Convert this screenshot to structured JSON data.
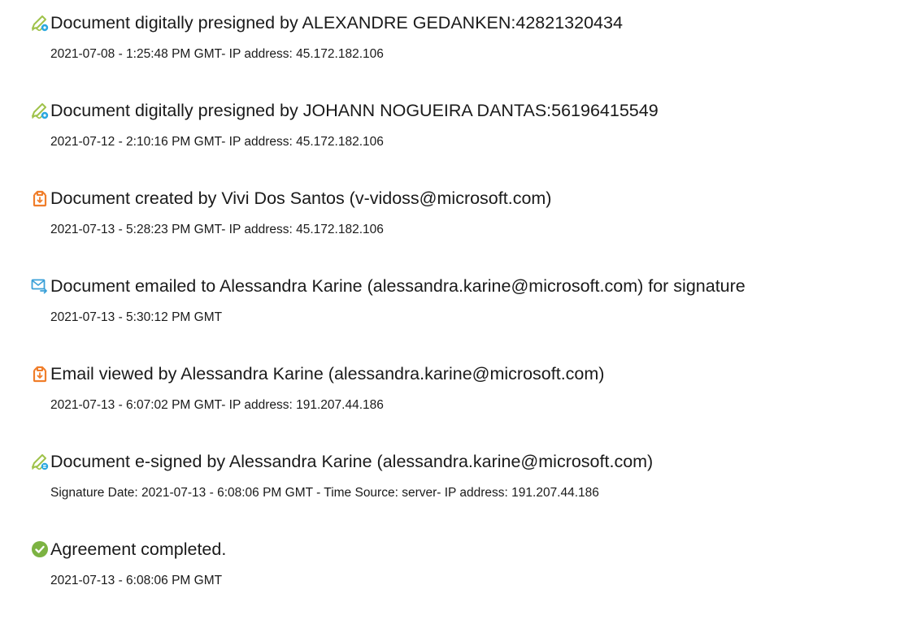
{
  "colors": {
    "text": "#1a1a1a",
    "pen_icon": "#9fc24a",
    "pen_badge": "#2aa8e0",
    "doc_icon": "#f07e2b",
    "mail_icon": "#3aa0d8",
    "check_icon": "#7cb342"
  },
  "events": [
    {
      "icon": "pen-presign-icon",
      "title": "Document digitally presigned by ALEXANDRE GEDANKEN:42821320434",
      "meta": "2021-07-08 - 1:25:48 PM GMT- IP address: 45.172.182.106"
    },
    {
      "icon": "pen-presign-icon",
      "title": "Document digitally presigned by JOHANN NOGUEIRA DANTAS:56196415549",
      "meta": "2021-07-12 - 2:10:16 PM GMT- IP address: 45.172.182.106"
    },
    {
      "icon": "document-created-icon",
      "title": "Document created by Vivi Dos Santos (v-vidoss@microsoft.com)",
      "meta": "2021-07-13 - 5:28:23 PM GMT- IP address: 45.172.182.106"
    },
    {
      "icon": "email-sent-icon",
      "title": "Document emailed to Alessandra Karine (alessandra.karine@microsoft.com) for signature",
      "meta": "2021-07-13 - 5:30:12 PM GMT"
    },
    {
      "icon": "document-viewed-icon",
      "title": "Email viewed by Alessandra Karine (alessandra.karine@microsoft.com)",
      "meta": "2021-07-13 - 6:07:02 PM GMT- IP address: 191.207.44.186"
    },
    {
      "icon": "pen-esign-icon",
      "title": "Document e-signed by Alessandra Karine (alessandra.karine@microsoft.com)",
      "meta": "Signature Date: 2021-07-13 - 6:08:06 PM GMT - Time Source: server- IP address: 191.207.44.186"
    },
    {
      "icon": "check-circle-icon",
      "title": "Agreement completed.",
      "meta": "2021-07-13 - 6:08:06 PM GMT"
    }
  ]
}
